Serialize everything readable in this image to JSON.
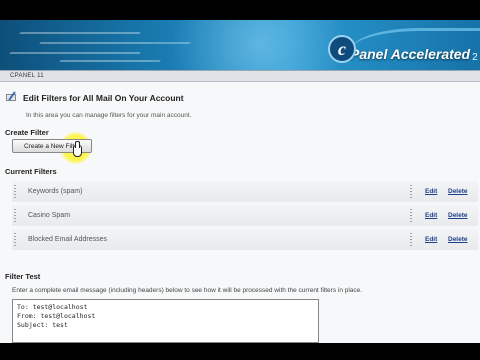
{
  "header": {
    "logo_mark": "c",
    "logo_text": "Panel Accelerated",
    "logo_sub": "2"
  },
  "breadcrumb": {
    "label": "CPANEL 11"
  },
  "page": {
    "title": "Edit Filters for All Mail On Your Account",
    "intro": "In this area you can manage filters for your main account."
  },
  "create_filter": {
    "heading": "Create Filter",
    "button_label": "Create a New Filter"
  },
  "current_filters": {
    "heading": "Current Filters",
    "edit_label": "Edit",
    "delete_label": "Delete",
    "items": [
      {
        "name": "Keywords (spam)"
      },
      {
        "name": "Casino Spam"
      },
      {
        "name": "Blocked Email Addresses"
      }
    ]
  },
  "filter_test": {
    "heading": "Filter Test",
    "description": "Enter a complete email message (including headers) below to see how it will be processed with the current filters in place.",
    "lines": [
      "To: test@localhost",
      "From: test@localhost",
      "Subject: test"
    ]
  }
}
